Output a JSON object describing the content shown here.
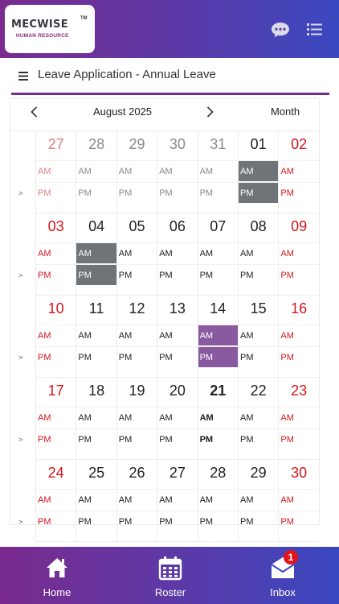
{
  "app": {
    "logo_text": "MECWISE",
    "logo_tm": "TM",
    "logo_subtitle": "HUMAN RESOURCE",
    "icons": [
      "chat-icon",
      "list-icon",
      "menu-icon",
      "home-icon",
      "calendar-icon",
      "mail-icon"
    ]
  },
  "header": {
    "title": "Leave Application - Annual Leave",
    "accent_color": "#7a2b8f"
  },
  "calendar": {
    "month_label": "August 2025",
    "view_label": "Month",
    "toggle_label": ">",
    "am_label": "AM",
    "pm_label": "PM",
    "weekend_color": "#d4151c",
    "highlight_gray": "#6f7479",
    "highlight_purple": "#8a5aa0",
    "weeks": [
      {
        "days": [
          {
            "num": "27",
            "muted": true,
            "weekend": true
          },
          {
            "num": "28",
            "muted": true
          },
          {
            "num": "29",
            "muted": true
          },
          {
            "num": "30",
            "muted": true
          },
          {
            "num": "31",
            "muted": true
          },
          {
            "num": "01",
            "highlight": "gray"
          },
          {
            "num": "02",
            "weekend": true
          }
        ]
      },
      {
        "days": [
          {
            "num": "03",
            "weekend": true
          },
          {
            "num": "04",
            "highlight": "gray"
          },
          {
            "num": "05"
          },
          {
            "num": "06"
          },
          {
            "num": "07"
          },
          {
            "num": "08"
          },
          {
            "num": "09",
            "weekend": true
          }
        ]
      },
      {
        "days": [
          {
            "num": "10",
            "weekend": true
          },
          {
            "num": "11"
          },
          {
            "num": "12"
          },
          {
            "num": "13"
          },
          {
            "num": "14",
            "highlight": "purple"
          },
          {
            "num": "15"
          },
          {
            "num": "16",
            "weekend": true
          }
        ]
      },
      {
        "days": [
          {
            "num": "17",
            "weekend": true
          },
          {
            "num": "18"
          },
          {
            "num": "19"
          },
          {
            "num": "20"
          },
          {
            "num": "21",
            "today": true
          },
          {
            "num": "22"
          },
          {
            "num": "23",
            "weekend": true
          }
        ]
      },
      {
        "days": [
          {
            "num": "24",
            "weekend": true
          },
          {
            "num": "25"
          },
          {
            "num": "26"
          },
          {
            "num": "27"
          },
          {
            "num": "28"
          },
          {
            "num": "29"
          },
          {
            "num": "30",
            "weekend": true
          }
        ]
      }
    ]
  },
  "bottom_nav": {
    "home_label": "Home",
    "roster_label": "Roster",
    "inbox_label": "Inbox",
    "inbox_badge": "1",
    "badge_color": "#e0161c"
  }
}
